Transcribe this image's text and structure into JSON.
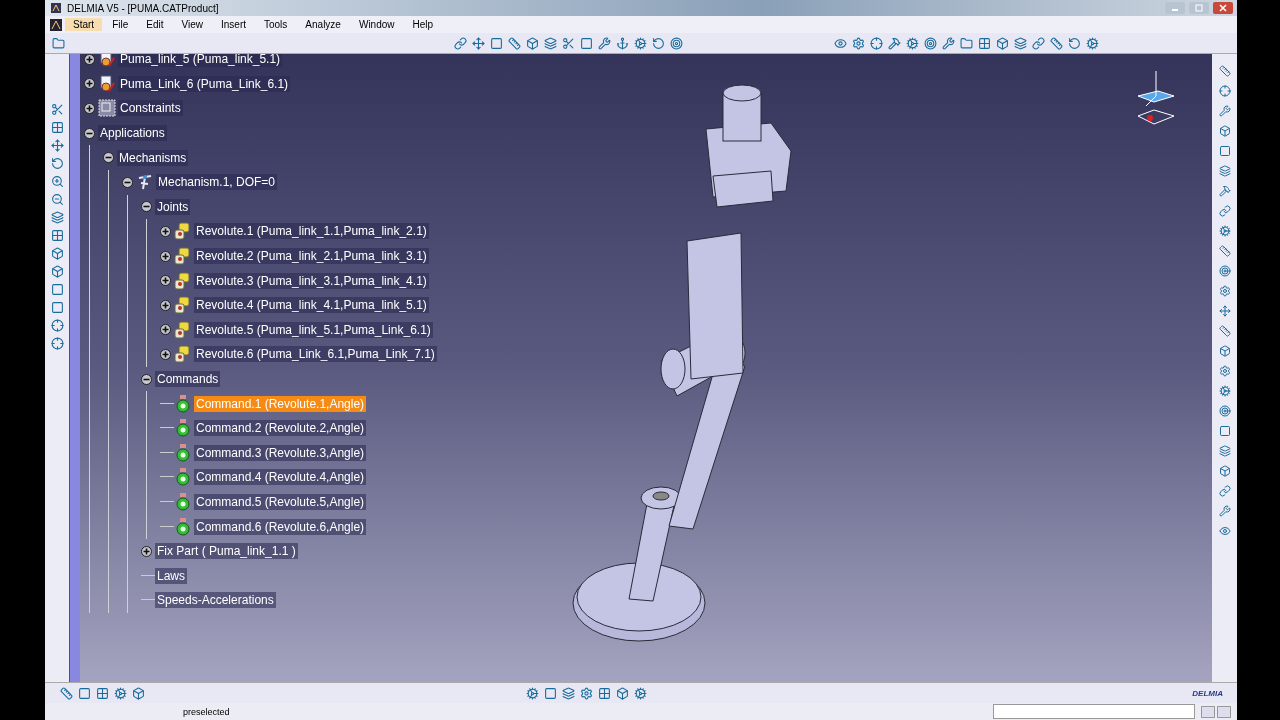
{
  "window": {
    "title": "DELMIA V5 - [PUMA.CATProduct]"
  },
  "menu": [
    {
      "label": "Start",
      "selected": true
    },
    {
      "label": "File",
      "selected": false
    },
    {
      "label": "Edit",
      "selected": false
    },
    {
      "label": "View",
      "selected": false
    },
    {
      "label": "Insert",
      "selected": false
    },
    {
      "label": "Tools",
      "selected": false
    },
    {
      "label": "Analyze",
      "selected": false
    },
    {
      "label": "Window",
      "selected": false
    },
    {
      "label": "Help",
      "selected": false
    }
  ],
  "tree": [
    {
      "label": "Puma_link_5 (Puma_link_5.1)",
      "kind": "part",
      "expanded": false,
      "selected": false
    },
    {
      "label": "Puma_Link_6 (Puma_Link_6.1)",
      "kind": "part",
      "expanded": false,
      "selected": false
    },
    {
      "label": "Constraints",
      "kind": "constraints",
      "expanded": false,
      "selected": false
    },
    {
      "label": "Applications",
      "expanded": true,
      "selected": false,
      "children": [
        {
          "label": "Mechanisms",
          "expanded": true,
          "selected": false,
          "children": [
            {
              "label": "Mechanism.1, DOF=0",
              "kind": "mechanism",
              "expanded": true,
              "selected": false,
              "children": [
                {
                  "label": "Joints",
                  "expanded": true,
                  "selected": false,
                  "children": [
                    {
                      "label": "Revolute.1 (Puma_link_1.1,Puma_link_2.1)",
                      "kind": "joint",
                      "expanded": false,
                      "selected": false
                    },
                    {
                      "label": "Revolute.2 (Puma_link_2.1,Puma_link_3.1)",
                      "kind": "joint",
                      "expanded": false,
                      "selected": false
                    },
                    {
                      "label": "Revolute.3 (Puma_link_3.1,Puma_link_4.1)",
                      "kind": "joint",
                      "expanded": false,
                      "selected": false
                    },
                    {
                      "label": "Revolute.4 (Puma_link_4.1,Puma_link_5.1)",
                      "kind": "joint",
                      "expanded": false,
                      "selected": false
                    },
                    {
                      "label": "Revolute.5 (Puma_link_5.1,Puma_Link_6.1)",
                      "kind": "joint",
                      "expanded": false,
                      "selected": false
                    },
                    {
                      "label": "Revolute.6 (Puma_Link_6.1,Puma_Link_7.1)",
                      "kind": "joint",
                      "expanded": false,
                      "selected": false
                    }
                  ]
                },
                {
                  "label": "Commands",
                  "expanded": true,
                  "selected": false,
                  "children": [
                    {
                      "label": "Command.1 (Revolute.1,Angle)",
                      "kind": "command",
                      "selected": true
                    },
                    {
                      "label": "Command.2 (Revolute.2,Angle)",
                      "kind": "command",
                      "selected": false
                    },
                    {
                      "label": "Command.3 (Revolute.3,Angle)",
                      "kind": "command",
                      "selected": false
                    },
                    {
                      "label": "Command.4 (Revolute.4,Angle)",
                      "kind": "command",
                      "selected": false
                    },
                    {
                      "label": "Command.5 (Revolute.5,Angle)",
                      "kind": "command",
                      "selected": false
                    },
                    {
                      "label": "Command.6 (Revolute.6,Angle)",
                      "kind": "command",
                      "selected": false
                    }
                  ]
                },
                {
                  "label": "Fix Part ( Puma_link_1.1 )",
                  "expanded": false,
                  "selected": false
                },
                {
                  "label": "Laws",
                  "selected": false
                },
                {
                  "label": "Speeds-Accelerations",
                  "selected": false
                }
              ]
            }
          ]
        }
      ]
    }
  ],
  "status_bar": {
    "message": "preselected"
  },
  "logo_text": "DELMIA"
}
